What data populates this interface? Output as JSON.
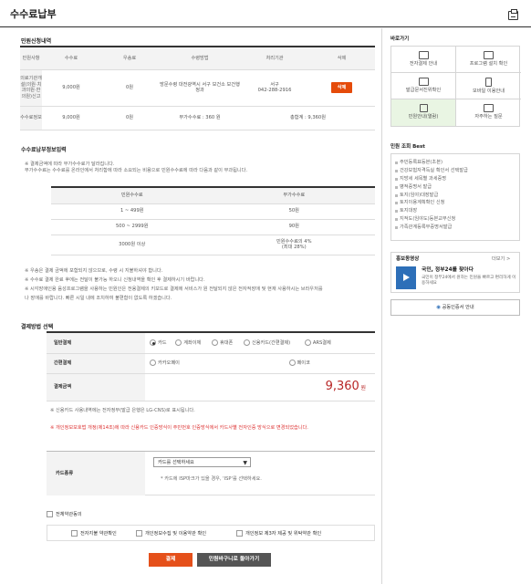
{
  "page": {
    "title": "수수료납부"
  },
  "apply": {
    "title": "민원신청내역",
    "headers": [
      "민원사항",
      "수수료",
      "우송료",
      "수령방법",
      "처리기관",
      "삭제"
    ],
    "row": {
      "name": "의료기관개설(의원·치과의원·한의원)신고",
      "fee": "9,000원",
      "postage": "0원",
      "receive": "방문수령 대전광역시 서구 보건소 보건행정과",
      "org": "서구",
      "tel": "042-288-2916",
      "delete_label": "삭제"
    },
    "summary": {
      "label": "수수료정보",
      "fee": "9,000원",
      "postage": "0원",
      "extra": "부가수수료 : 360 원",
      "total": "총합계 : 9,360원"
    }
  },
  "fee_info": {
    "title": "수수료납부정보입력",
    "notes": [
      "※ 결제금액에 따라 부가수수료가 달라집니다.",
      "부가수수료는 수수료를 온라인에서 처리함에 따라 소요되는 비용으로 민원수수료에 따라 다음과 같이 부과됩니다."
    ],
    "headers": [
      "민원수수료",
      "부가수수료"
    ],
    "rows": [
      [
        "1 ~ 499원",
        "50원"
      ],
      [
        "500 ~ 2999원",
        "90원"
      ],
      [
        "3000원 이상",
        "민원수수료의 4%|(최대 28%)"
      ]
    ],
    "notes2": [
      "※ 우송은 결제 금액에 포함되지 않으므로, 수령 시 지불하셔야 합니다.",
      "※ 수수료 결제 완료 후에는 전달이 불가능 하오니 신청내역을 확인 후 결제하시기 바랍니다.",
      "※ 시각장애인용 음성프로그램을 사용하는 민원인은 전용결제의 키보드로 결제에 서비스가 원 전달되지 않은 전자적장애 및 현재 사용하시는 브라우저를",
      "나 장애를 바랍니다. 빠른 시일 내에 조치하여 불편함이 없도록 하겠습니다."
    ]
  },
  "payment": {
    "title": "결제방법 선택",
    "general_label": "일반결제",
    "options": [
      "카드",
      "계좌이체",
      "휴대폰",
      "신용카드(간편결제)",
      "ARS결제"
    ],
    "simple_label": "간편결제",
    "simple_options": [
      "카카오페이",
      "페이코"
    ],
    "amount_label": "결제금액",
    "amount_value": "9,360",
    "amount_unit": "원",
    "note1": "※ 신용카드 사용내역에는 전자정부(발급 은행은 LG-CNS)로 표시됩니다.",
    "note2": "※ 개인정보보호법 개정(제14조)에 따라 신용카드 인증방식이 주민번호 인증방식에서 카드사별 전자인증 방식으로 변경되었습니다.",
    "card_label": "카드종류",
    "card_placeholder": "카드를 선택하세요",
    "card_hint": "* 카드에 ISP마크가 있을 경우, 'ISP'를 선택하세요."
  },
  "agree": {
    "all": "전체약관동의",
    "items": [
      "전자지불 약관확인",
      "개인정보수집 및 이용약관 확인",
      "개인정보 제3자 제공 및 위탁약관 확인"
    ]
  },
  "buttons": {
    "pay": "결제",
    "back": "민원바구니로 돌아가기"
  },
  "side": {
    "quick_title": "바로가기",
    "quick": [
      "전자결제 안내",
      "프로그램 설치 확인",
      "발급문서진위확인",
      "모바일 이용안내",
      "민원안내(열람)",
      "자주하는 질문"
    ],
    "best_title": "민원 조회 Best",
    "best": [
      "주민등록표등본(초본)",
      "건강보험자격득실 확인서 선택발급",
      "지방세 세목별 과세증명",
      "병적증명서 발급",
      "토지(임야)대장발급",
      "토지이용계획확인 신청",
      "토지대장",
      "지적도(임야도)등본교부신청",
      "가족관계등록부증명서발급"
    ],
    "promo_title": "홍보동영상",
    "promo_more": "더보기 >",
    "promo_text": "국민, 정부24를 찾아다",
    "promo_sub": "국민이 정부24에서 원하는 민원을 빠르고 편리하게 이용하세요",
    "cert": "공동인증서 안내"
  }
}
